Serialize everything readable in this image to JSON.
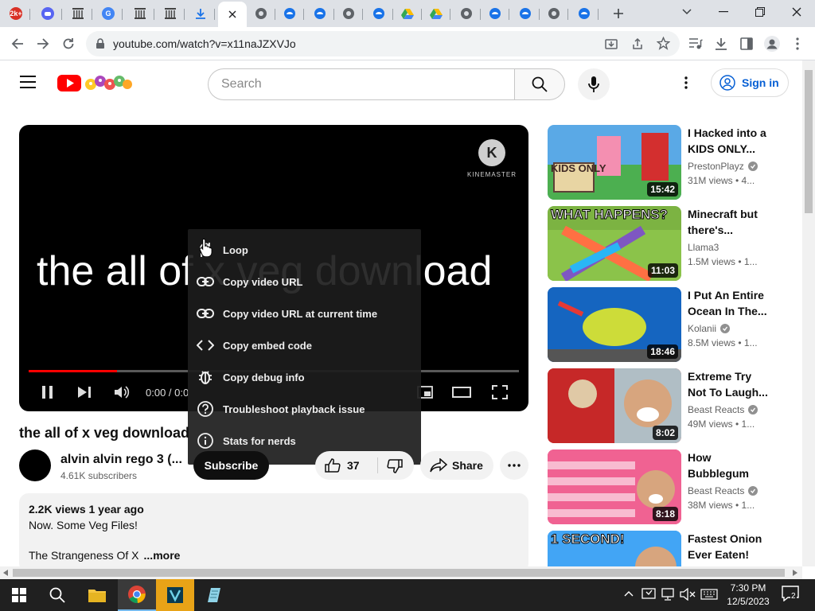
{
  "browser": {
    "tabs": [
      {
        "icon": "badge-favicon",
        "color": "#d93025",
        "glyph": "2k+"
      },
      {
        "icon": "discord-favicon",
        "color": "#5865f2",
        "glyph": ""
      },
      {
        "icon": "archive-favicon",
        "color": "#444444",
        "glyph": ""
      },
      {
        "icon": "google-favicon",
        "color": "#4285f4",
        "glyph": "G"
      },
      {
        "icon": "archive-favicon",
        "color": "#444444",
        "glyph": ""
      },
      {
        "icon": "archive-favicon",
        "color": "#444444",
        "glyph": ""
      },
      {
        "icon": "download-favicon",
        "color": "#1a73e8",
        "glyph": ""
      },
      {
        "icon": "active-tab-close",
        "color": "#ffffff",
        "glyph": ""
      },
      {
        "icon": "globe-favicon",
        "color": "#5f6368",
        "glyph": ""
      },
      {
        "icon": "edge-favicon",
        "color": "#1a73e8",
        "glyph": ""
      },
      {
        "icon": "edge-favicon",
        "color": "#1a73e8",
        "glyph": ""
      },
      {
        "icon": "globe-favicon",
        "color": "#5f6368",
        "glyph": ""
      },
      {
        "icon": "edge-favicon",
        "color": "#1a73e8",
        "glyph": ""
      },
      {
        "icon": "drive-favicon",
        "color": "#0f9d58",
        "glyph": ""
      },
      {
        "icon": "drive-favicon",
        "color": "#0f9d58",
        "glyph": ""
      },
      {
        "icon": "globe-favicon",
        "color": "#5f6368",
        "glyph": ""
      },
      {
        "icon": "edge-favicon",
        "color": "#1a73e8",
        "glyph": ""
      },
      {
        "icon": "edge-favicon",
        "color": "#1a73e8",
        "glyph": ""
      },
      {
        "icon": "globe-favicon",
        "color": "#5f6368",
        "glyph": ""
      },
      {
        "icon": "edge-favicon",
        "color": "#1a73e8",
        "glyph": ""
      }
    ],
    "url": "youtube.com/watch?v=x11naJZXVJo"
  },
  "youtube": {
    "search_placeholder": "Search",
    "sign_in": "Sign in",
    "accent": "#ff0000",
    "link_color": "#065fd4"
  },
  "player": {
    "overlay_text": "the all of x veg download",
    "watermark": "KINEMASTER",
    "time": "0:00 / 0:0",
    "progress_fraction": 0.18
  },
  "context_menu": [
    {
      "icon": "loop-icon",
      "label": "Loop"
    },
    {
      "icon": "link-icon",
      "label": "Copy video URL"
    },
    {
      "icon": "link-icon",
      "label": "Copy video URL at current time"
    },
    {
      "icon": "embed-code-icon",
      "label": "Copy embed code"
    },
    {
      "icon": "debug-bug-icon",
      "label": "Copy debug info"
    },
    {
      "icon": "question-icon",
      "label": "Troubleshoot playback issue"
    },
    {
      "icon": "info-icon",
      "label": "Stats for nerds"
    }
  ],
  "video": {
    "title": "the all of x veg download",
    "channel": "alvin alvin rego 3 (...",
    "subscribers": "4.61K subscribers",
    "subscribe_label": "Subscribe",
    "likes": "37",
    "share_label": "Share",
    "description": {
      "meta": "2.2K views  1 year ago",
      "line1": "Now. Some Veg Files!",
      "line2": "The Strangeness Of X",
      "more": "...more"
    }
  },
  "recommendations": [
    {
      "title": "I Hacked into a KIDS ONLY...",
      "channel": "PrestonPlayz",
      "verified": true,
      "views": "31M views  • 4...",
      "duration": "15:42",
      "thumb_color": "#5aa9e6",
      "thumb_text": "KIDS ONLY"
    },
    {
      "title": "Minecraft but there's...",
      "channel": "Llama3",
      "verified": false,
      "views": "1.5M views  • 1...",
      "duration": "11:03",
      "thumb_color": "#7cb342",
      "thumb_text": "WHAT HAPPENS?"
    },
    {
      "title": "I Put An Entire Ocean In The...",
      "channel": "Kolanii",
      "verified": true,
      "views": "8.5M views  • 1...",
      "duration": "18:46",
      "thumb_color": "#3a7bd5",
      "thumb_text": ""
    },
    {
      "title": "Extreme Try Not To Laugh...",
      "channel": "Beast Reacts",
      "verified": true,
      "views": "49M views  • 1...",
      "duration": "8:02",
      "thumb_color": "#e53935",
      "thumb_text": ""
    },
    {
      "title": "How Bubblegum Is...",
      "channel": "Beast Reacts",
      "verified": true,
      "views": "38M views  • 1...",
      "duration": "8:18",
      "thumb_color": "#ec407a",
      "thumb_text": ""
    },
    {
      "title": "Fastest Onion Ever Eaten!",
      "channel": "",
      "verified": false,
      "views": "",
      "duration": "",
      "thumb_color": "#1e88e5",
      "thumb_text": "1 SECOND!"
    }
  ],
  "taskbar": {
    "time": "7:30 PM",
    "date": "12/5/2023",
    "notifications": "2"
  }
}
